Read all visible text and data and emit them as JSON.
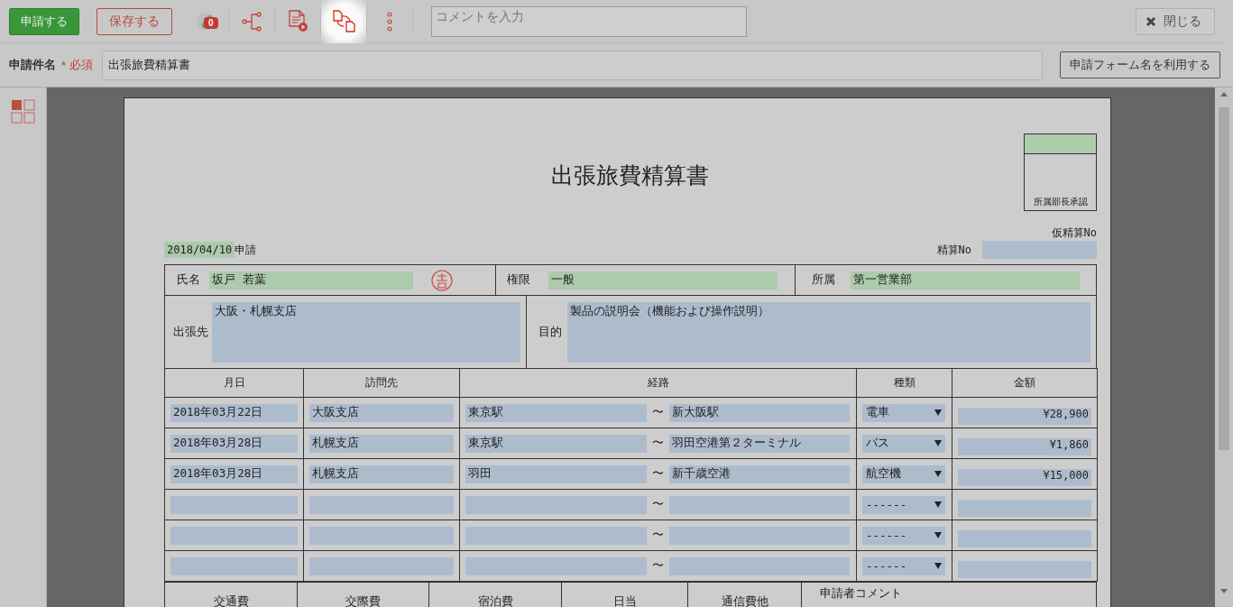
{
  "toolbar": {
    "submit_button": "申請する",
    "save_button": "保存する",
    "icons": [
      {
        "kind": "attachment",
        "badge": "0",
        "highlighted": false
      },
      {
        "kind": "route",
        "highlighted": false
      },
      {
        "kind": "preview",
        "highlighted": false
      },
      {
        "kind": "copy",
        "highlighted": true
      },
      {
        "kind": "more",
        "highlighted": false
      }
    ],
    "comment_placeholder": "コメントを入力",
    "close_button": "閉じる"
  },
  "subject": {
    "label": "申請件名",
    "required_mark": "*",
    "required_text": "必須",
    "value": "出張旅費精算書",
    "use_form_name_button": "申請フォーム名を利用する"
  },
  "form": {
    "title": "出張旅費精算書",
    "approval_label": "所属部長承認",
    "provisional_no_label": "仮精算No",
    "settlement_no_label": "精算No",
    "date": "2018/04/10",
    "date_suffix": "申請",
    "name_label": "氏名",
    "name": "坂戸 若葉",
    "authority_label": "権限",
    "authority": "一般",
    "department_label": "所属",
    "department": "第一営業部",
    "destination_label": "出張先",
    "destination": "大阪・札幌支店",
    "purpose_label": "目的",
    "purpose": "製品の説明会（機能および操作説明）",
    "columns": [
      "月日",
      "訪問先",
      "経路",
      "種類",
      "金額"
    ],
    "rows": [
      {
        "date": "2018年03月22日",
        "visit": "大阪支店",
        "from": "東京駅",
        "separator": "〜",
        "to": "新大阪駅",
        "type": "電車",
        "amount": "¥28,900"
      },
      {
        "date": "2018年03月28日",
        "visit": "札幌支店",
        "from": "東京駅",
        "separator": "〜",
        "to": "羽田空港第２ターミナル",
        "type": "バス",
        "amount": "¥1,860"
      },
      {
        "date": "2018年03月28日",
        "visit": "札幌支店",
        "from": "羽田",
        "separator": "〜",
        "to": "新千歳空港",
        "type": "航空機",
        "amount": "¥15,000"
      },
      {
        "separator": "〜",
        "type": "------"
      },
      {
        "separator": "〜",
        "type": "------"
      },
      {
        "separator": "〜",
        "type": "------"
      }
    ],
    "summary_columns": [
      "交通費",
      "交際費",
      "宿泊費",
      "日当",
      "通信費他"
    ],
    "comment_label": "申請者コメント"
  }
}
